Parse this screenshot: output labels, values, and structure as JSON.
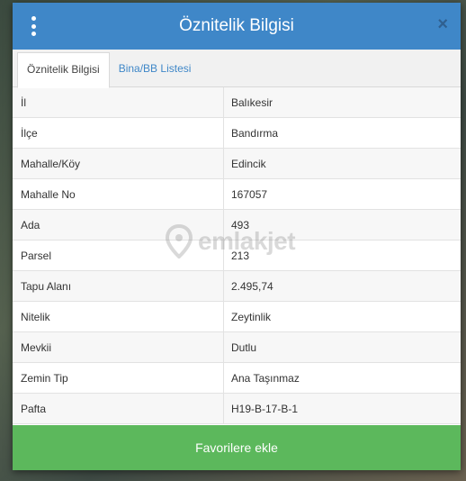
{
  "header": {
    "title": "Öznitelik Bilgisi",
    "menu_icon": "vertical-ellipsis-icon",
    "close_label": "×",
    "accent": "#3f87c8"
  },
  "tabs": [
    {
      "label": "Öznitelik Bilgisi",
      "active": true
    },
    {
      "label": "Bina/BB Listesi",
      "active": false
    }
  ],
  "attributes": [
    {
      "key": "İl",
      "value": "Balıkesir"
    },
    {
      "key": "İlçe",
      "value": "Bandırma"
    },
    {
      "key": "Mahalle/Köy",
      "value": "Edincik"
    },
    {
      "key": "Mahalle No",
      "value": "167057"
    },
    {
      "key": "Ada",
      "value": "493"
    },
    {
      "key": "Parsel",
      "value": "213"
    },
    {
      "key": "Tapu Alanı",
      "value": "2.495,74"
    },
    {
      "key": "Nitelik",
      "value": "Zeytinlik"
    },
    {
      "key": "Mevkii",
      "value": "Dutlu"
    },
    {
      "key": "Zemin Tip",
      "value": "Ana Taşınmaz"
    },
    {
      "key": "Pafta",
      "value": "H19-B-17-B-1"
    }
  ],
  "watermark": {
    "text": "emlakjet",
    "icon": "location-pin-icon"
  },
  "footer": {
    "button_label": "Favorilere ekle",
    "color": "#5cb85c"
  }
}
